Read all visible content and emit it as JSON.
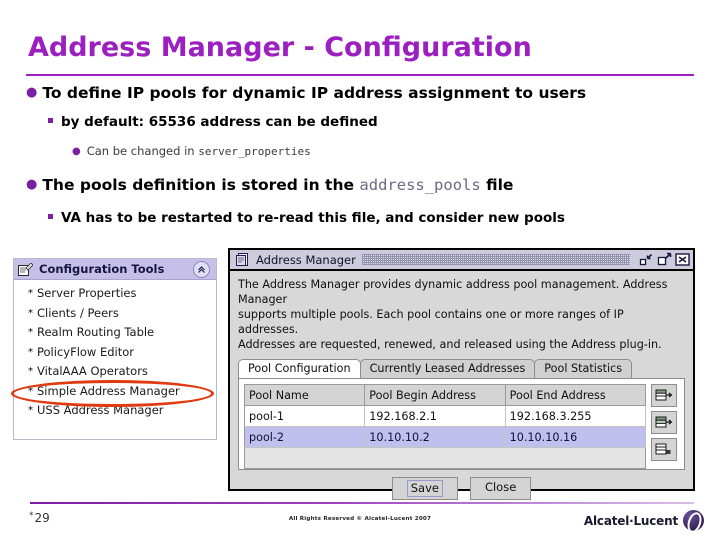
{
  "slide": {
    "title": "Address Manager - Configuration",
    "page_number": "29",
    "copyright": "All Rights Reserved © Alcatel-Lucent 2007",
    "brand": "Alcatel·Lucent",
    "accent_color": "#9B1FC1"
  },
  "bullets": {
    "b1": "To define IP pools for dynamic IP address assignment to users",
    "b1_sub": "by default: 65536 address can be defined",
    "b1_sub_sub_prefix": "Can be changed in ",
    "b1_sub_sub_code": "server_properties",
    "b2_prefix": "The pools definition is stored in the ",
    "b2_code": "address_pools",
    "b2_suffix": " file",
    "b2_sub": "VA has to be restarted to re-read this file, and consider new pools"
  },
  "config_panel": {
    "header": "Configuration Tools",
    "collapse_icon": "chevron-up-icon",
    "panel_icon": "document-pencil-icon",
    "items": [
      {
        "label": "Server Properties"
      },
      {
        "label": "Clients / Peers"
      },
      {
        "label": "Realm Routing Table"
      },
      {
        "label": "PolicyFlow Editor"
      },
      {
        "label": "VitalAAA Operators"
      },
      {
        "label": "Simple Address Manager"
      },
      {
        "label": "USS Address Manager"
      }
    ],
    "highlight": {
      "target": "Simple Address Manager",
      "color": "#E03A10"
    }
  },
  "dialog": {
    "title": "Address Manager",
    "window_icon": "application-window-icon",
    "controls": [
      {
        "name": "minimize-button",
        "glyph": "minimize-icon"
      },
      {
        "name": "maximize-button",
        "glyph": "maximize-icon"
      },
      {
        "name": "close-button",
        "glyph": "close-icon"
      }
    ],
    "description": [
      "The Address Manager provides dynamic address pool management. Address Manager",
      "supports multiple pools. Each pool contains one or more ranges of IP addresses.",
      "Addresses are requested, renewed, and released using the Address plug-in."
    ],
    "tabs": [
      {
        "label": "Pool Configuration",
        "active": true
      },
      {
        "label": "Currently Leased Addresses",
        "active": false
      },
      {
        "label": "Pool Statistics",
        "active": false
      }
    ],
    "table": {
      "columns": [
        "Pool Name",
        "Pool Begin Address",
        "Pool End Address"
      ],
      "rows": [
        {
          "cells": [
            "pool-1",
            "192.168.2.1",
            "192.168.3.255"
          ],
          "selected": false
        },
        {
          "cells": [
            "pool-2",
            "10.10.10.2",
            "10.10.10.16"
          ],
          "selected": true
        }
      ],
      "selection_color": "#BFC0EE"
    },
    "row_tools": [
      {
        "name": "add-row-button",
        "glyph": "add-row-icon"
      },
      {
        "name": "insert-row-button",
        "glyph": "insert-row-icon"
      },
      {
        "name": "delete-row-button",
        "glyph": "delete-row-icon"
      }
    ],
    "buttons": {
      "save": "Save",
      "close": "Close"
    }
  }
}
